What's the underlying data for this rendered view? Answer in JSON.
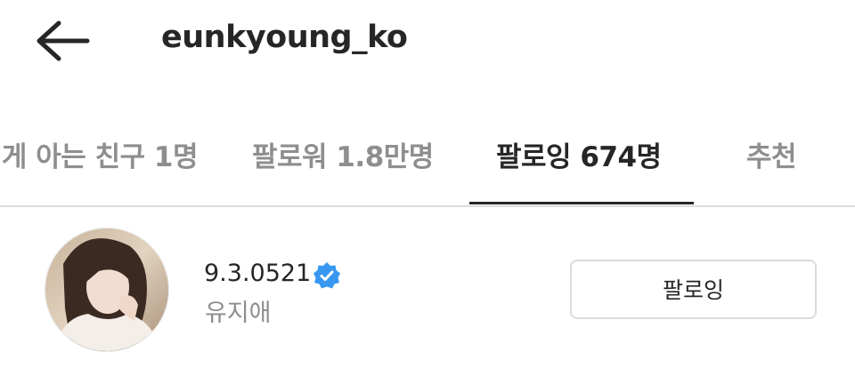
{
  "header": {
    "back_icon": "arrow-left-icon",
    "username": "eunkyoung_ko"
  },
  "tabs": [
    {
      "label": "게 아는 친구 1명",
      "active": false
    },
    {
      "label": "팔로워 1.8만명",
      "active": false
    },
    {
      "label": "팔로잉 674명",
      "active": true
    },
    {
      "label": "추천",
      "active": false
    }
  ],
  "user": {
    "username": "9.3.0521",
    "verified": true,
    "verified_icon": "verified-badge-icon",
    "full_name": "유지애",
    "follow_button_label": "팔로잉"
  },
  "colors": {
    "text_primary": "#262626",
    "text_secondary": "#8e8e8e",
    "verified_blue": "#3897f0",
    "divider": "#dbdbdb"
  }
}
